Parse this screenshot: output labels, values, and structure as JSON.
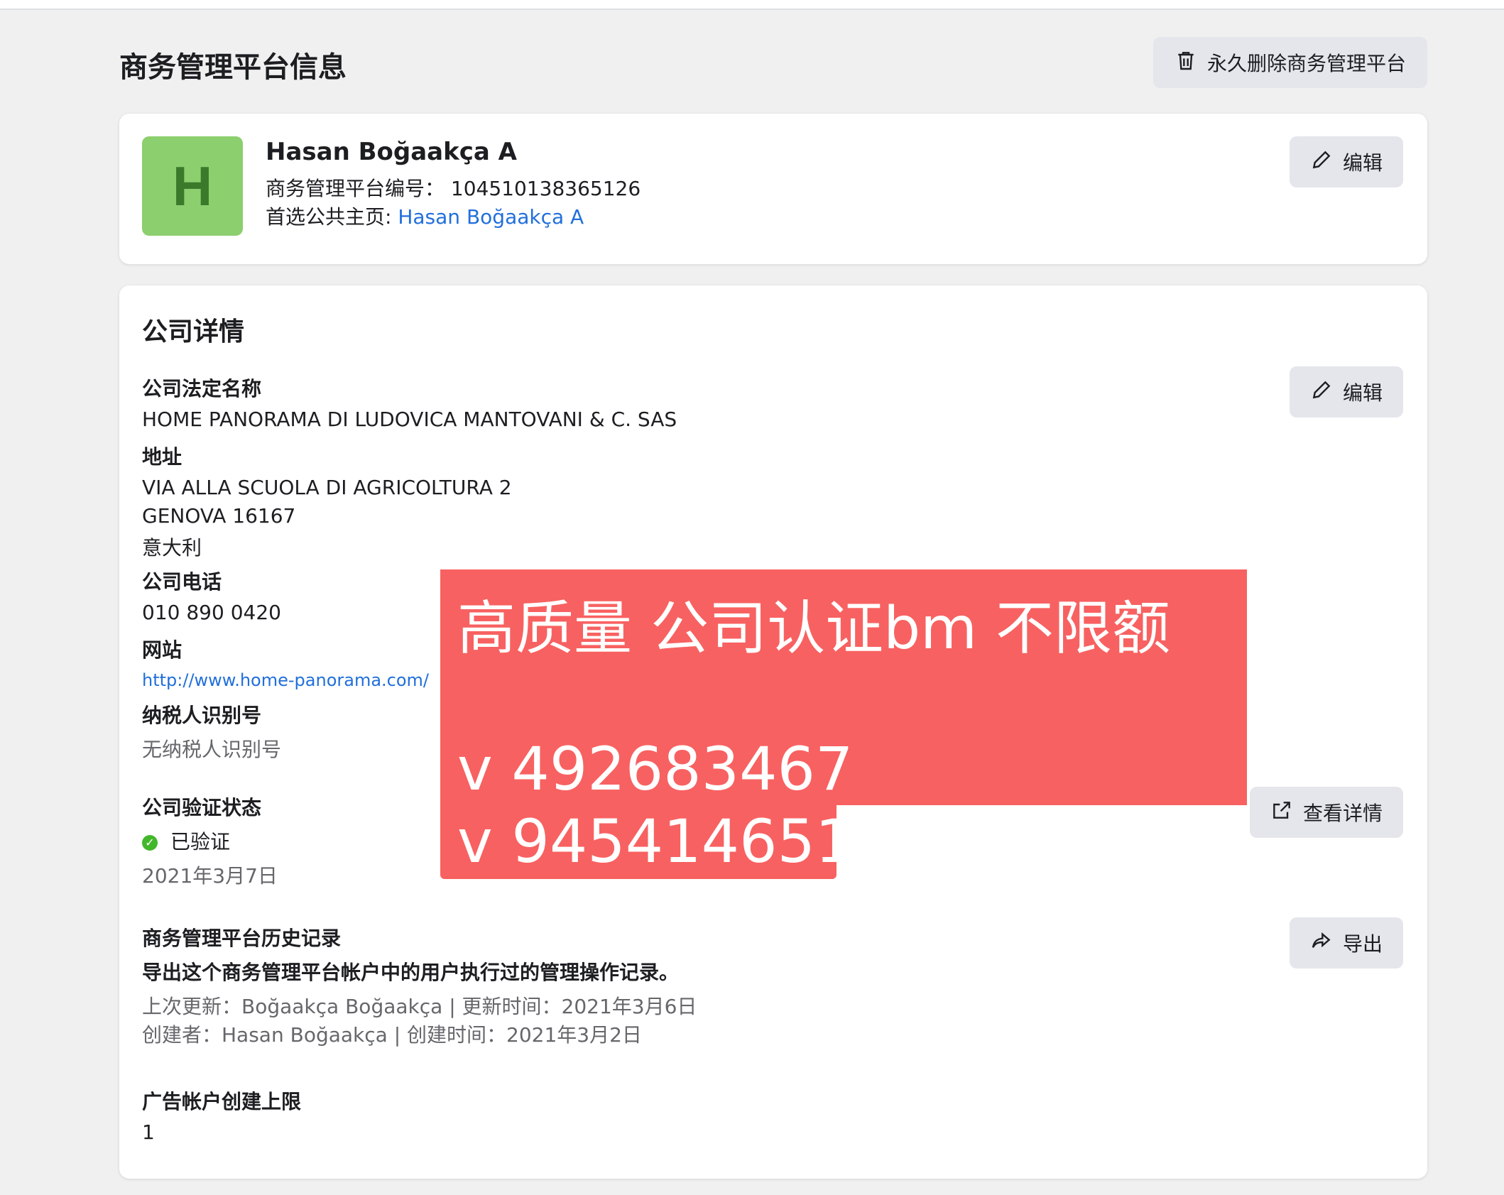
{
  "header": {
    "title": "商务管理平台信息",
    "delete_label": "永久删除商务管理平台"
  },
  "profile": {
    "avatar_letter": "H",
    "name": "Hasan Boğaakça A",
    "id_label": "商务管理平台编号：",
    "id_value": "104510138365126",
    "page_label": "首选公共主页: ",
    "page_value": "Hasan Boğaakça A",
    "edit_label": "编辑"
  },
  "company": {
    "section_title": "公司详情",
    "edit_label": "编辑",
    "legal_name_label": "公司法定名称",
    "legal_name": "HOME PANORAMA DI LUDOVICA MANTOVANI & C. SAS",
    "address_label": "地址",
    "address_line1": "VIA ALLA SCUOLA DI AGRICOLTURA 2",
    "address_line2": "GENOVA 16167",
    "address_line3": "意大利",
    "phone_label": "公司电话",
    "phone": "010 890 0420",
    "website_label": "网站",
    "website": "http://www.home-panorama.com/",
    "tax_label": "纳税人识别号",
    "tax_value": "无纳税人识别号",
    "verify_label": "公司验证状态",
    "verify_status": "已验证",
    "verify_date": "2021年3月7日",
    "view_details_label": "查看详情",
    "history_label": "商务管理平台历史记录",
    "history_desc": "导出这个商务管理平台帐户中的用户执行过的管理操作记录。",
    "history_updated": "上次更新：Boğaakça Boğaakça | 更新时间：2021年3月6日",
    "history_created": "创建者：Hasan Boğaakça | 创建时间：2021年3月2日",
    "export_label": "导出",
    "ad_limit_label": "广告帐户创建上限",
    "ad_limit_value": "1"
  },
  "overlay": {
    "title": "高质量  公司认证bm 不限额",
    "contact1": "v 492683467",
    "contact2": "v 945414651",
    "color": "#f86161"
  },
  "icons": {
    "delete": "trash-icon",
    "edit": "pencil-icon",
    "view": "external-link-icon",
    "export": "share-arrow-icon",
    "verified": "check-circle-icon"
  }
}
